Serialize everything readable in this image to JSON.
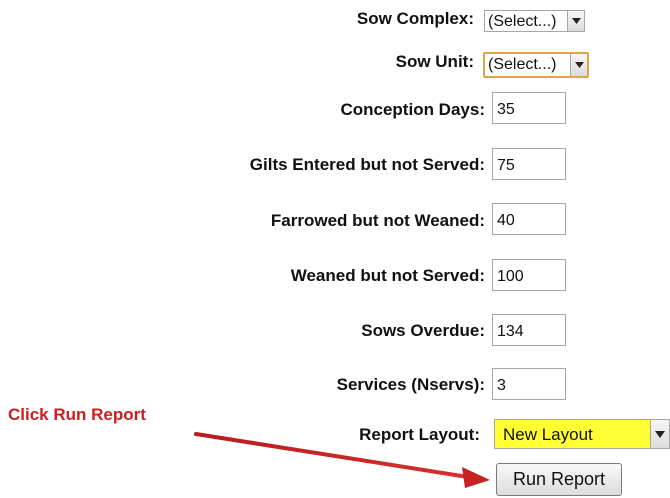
{
  "form": {
    "sow_complex": {
      "label": "Sow Complex:",
      "value": "(Select...)"
    },
    "sow_unit": {
      "label": "Sow Unit:",
      "value": "(Select...)"
    },
    "conception_days": {
      "label": "Conception Days:",
      "value": "35"
    },
    "gilts_entered": {
      "label": "Gilts Entered but not Served:",
      "value": "75"
    },
    "farrowed": {
      "label": "Farrowed but not Weaned:",
      "value": "40"
    },
    "weaned": {
      "label": "Weaned but not Served:",
      "value": "100"
    },
    "sows_overdue": {
      "label": "Sows Overdue:",
      "value": "134"
    },
    "services": {
      "label": "Services (Nservs):",
      "value": "3"
    },
    "report_layout": {
      "label": "Report Layout:",
      "value": "New Layout"
    },
    "run_report_label": "Run Report"
  },
  "annotation": {
    "text": "Click Run Report",
    "color": "#cc1f1f"
  },
  "colors": {
    "highlight": "#ffff33",
    "sow_unit_focus_border": "#e1a545"
  },
  "icons": {
    "dropdown": "chevron-down-icon",
    "pointer": "arrow-pointer-icon"
  }
}
